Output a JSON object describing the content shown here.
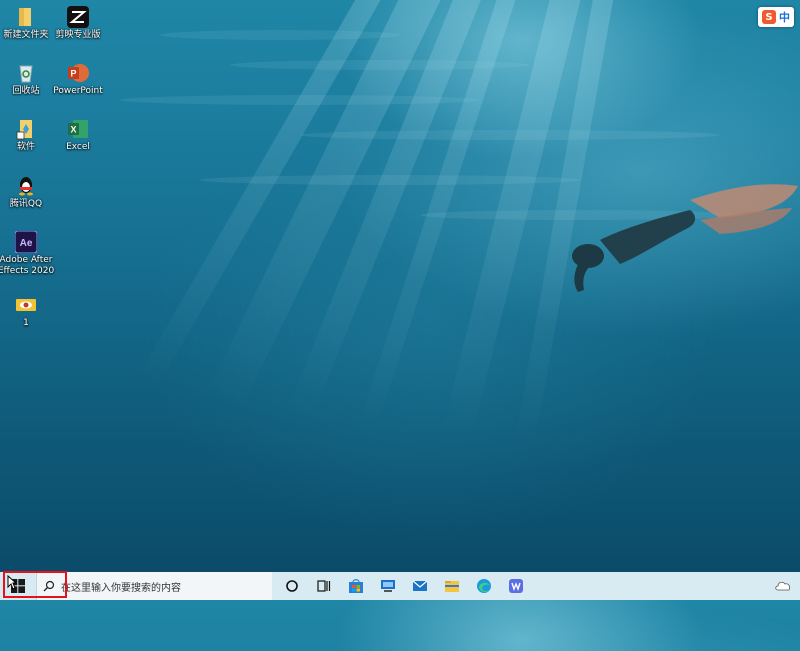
{
  "desktop": {
    "icons": [
      {
        "label": "新建文件夹",
        "icon": "folder-icon"
      },
      {
        "label": "剪映专业版",
        "icon": "capcut-icon"
      },
      {
        "label": "回收站",
        "icon": "recycle-bin-icon"
      },
      {
        "label": "PowerPoint",
        "icon": "powerpoint-icon"
      },
      {
        "label": "软件",
        "icon": "software-shortcut-icon"
      },
      {
        "label": "Excel",
        "icon": "excel-icon"
      },
      {
        "label": "腾讯QQ",
        "icon": "qq-icon"
      },
      {
        "label": "Adobe After\nEffects 2020",
        "icon": "after-effects-icon"
      },
      {
        "label": "1",
        "icon": "image-file-icon"
      }
    ]
  },
  "ime": {
    "logo": "S",
    "mode": "中"
  },
  "taskbar": {
    "start_icon": "windows-start-icon",
    "search_placeholder": "在这里输入你要搜索的内容",
    "buttons": [
      "cortana-icon",
      "task-view-icon",
      "microsoft-store-icon",
      "computer-icon",
      "mail-icon",
      "file-explorer-icon",
      "edge-icon",
      "wps-icon"
    ],
    "tray": [
      "onedrive-cloud-icon"
    ]
  },
  "colors": {
    "highlight": "#e8101a",
    "taskbar": "#d8ebf2",
    "water": "#156d8e"
  }
}
